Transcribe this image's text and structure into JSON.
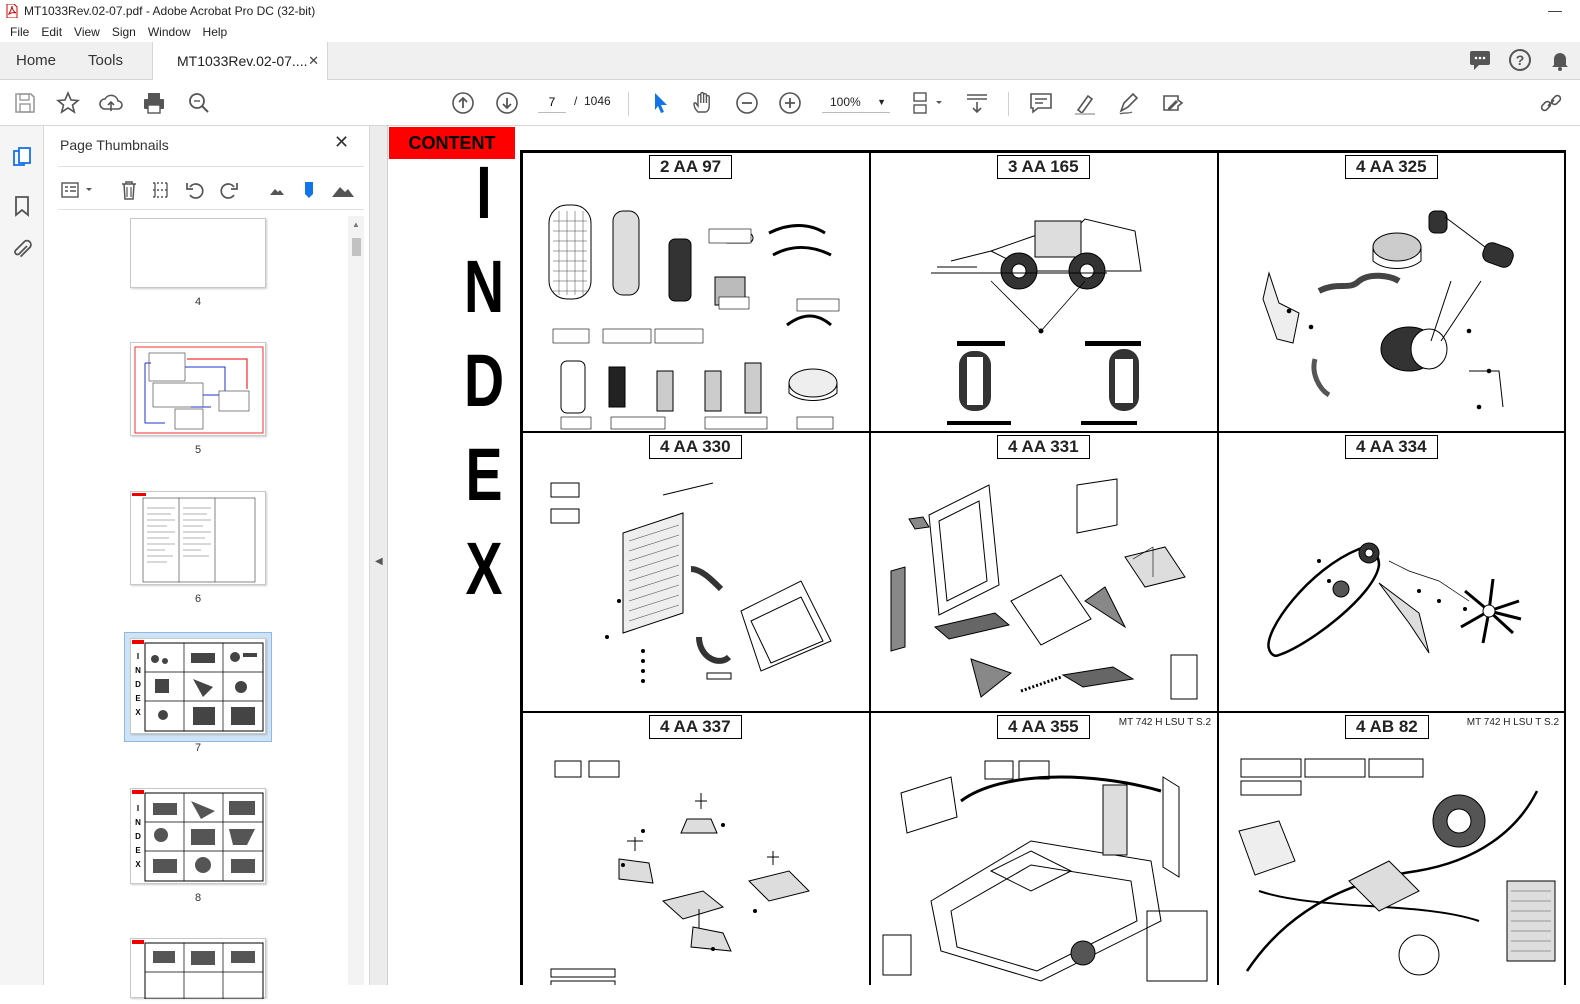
{
  "window": {
    "title": "MT1033Rev.02-07.pdf - Adobe Acrobat Pro DC (32-bit)"
  },
  "menu": [
    "File",
    "Edit",
    "View",
    "Sign",
    "Window",
    "Help"
  ],
  "tabs": {
    "home": "Home",
    "tools": "Tools",
    "document": "MT1033Rev.02-07...."
  },
  "toolbar": {
    "current_page": "7",
    "separator": "/",
    "total_pages": "1046",
    "zoom": "100%"
  },
  "panel": {
    "title": "Page Thumbnails",
    "thumbnails": [
      {
        "label": "4"
      },
      {
        "label": "5"
      },
      {
        "label": "6"
      },
      {
        "label": "7",
        "selected": true
      },
      {
        "label": "8"
      }
    ]
  },
  "document": {
    "content_tag": "CONTENT",
    "index_letters": [
      "I",
      "N",
      "D",
      "E",
      "X"
    ],
    "cells": [
      {
        "code": "2 AA 97",
        "note": ""
      },
      {
        "code": "3 AA 165",
        "note": ""
      },
      {
        "code": "4 AA 325",
        "note": ""
      },
      {
        "code": "4 AA 330",
        "note": ""
      },
      {
        "code": "4 AA 331",
        "note": ""
      },
      {
        "code": "4 AA 334",
        "note": ""
      },
      {
        "code": "4 AA 337",
        "note": ""
      },
      {
        "code": "4 AA 355",
        "note": "MT 742 H LSU T S.2"
      },
      {
        "code": "4 AB 82",
        "note": "MT 742 H LSU T S.2"
      }
    ]
  },
  "colors": {
    "accent_red": "#ff0000",
    "selection_blue": "#cfe3f7",
    "select_tool_blue": "#1473e6"
  }
}
